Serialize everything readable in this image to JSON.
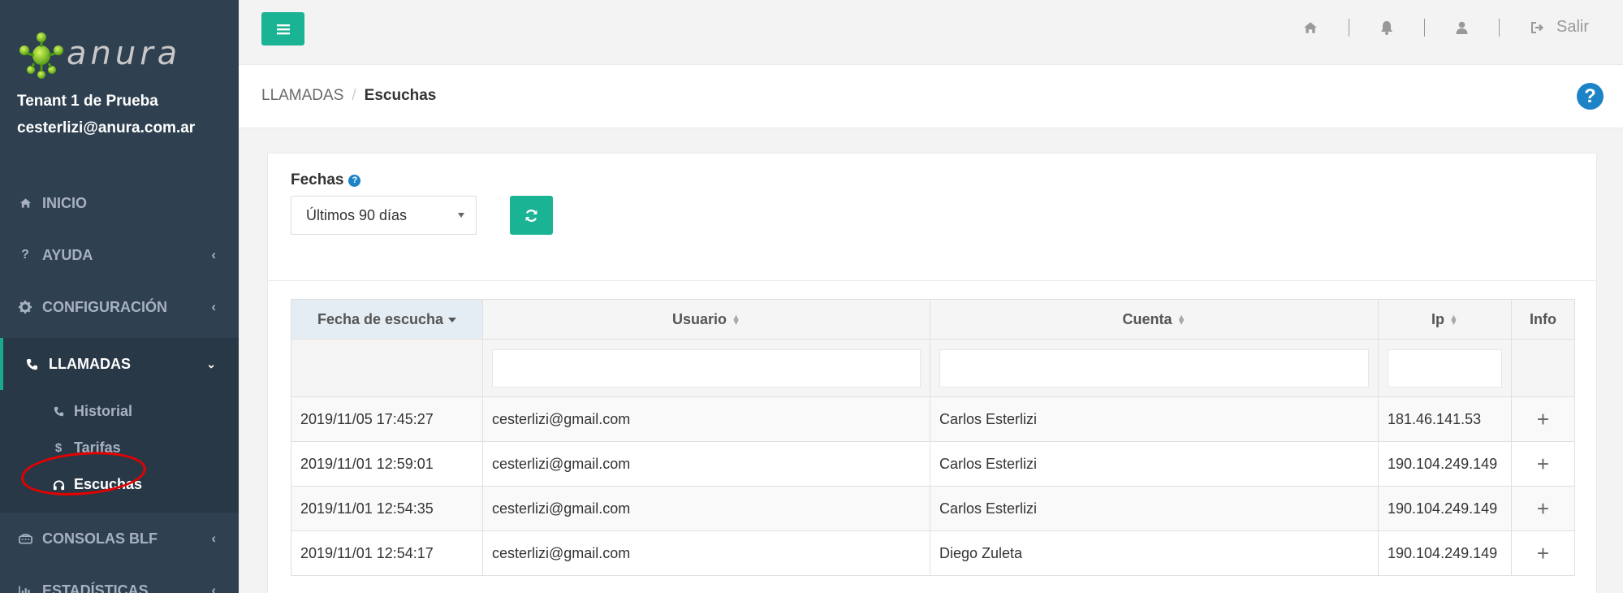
{
  "brand": {
    "logo_text": "anura"
  },
  "user": {
    "tenant": "Tenant 1 de Prueba",
    "email": "cesterlizi@anura.com.ar"
  },
  "sidebar": {
    "items": [
      {
        "label": "INICIO",
        "icon": "home-icon"
      },
      {
        "label": "AYUDA",
        "icon": "question-icon"
      },
      {
        "label": "CONFIGURACIÓN",
        "icon": "gear-icon"
      },
      {
        "label": "LLAMADAS",
        "icon": "phone-icon"
      },
      {
        "label": "CONSOLAS BLF",
        "icon": "console-icon"
      },
      {
        "label": "ESTADÍSTICAS",
        "icon": "bar-chart-icon"
      }
    ],
    "subitems": [
      {
        "label": "Historial",
        "icon": "phone-icon"
      },
      {
        "label": "Tarifas",
        "icon": "dollar-icon"
      },
      {
        "label": "Escuchas",
        "icon": "headphones-icon"
      }
    ]
  },
  "topbar": {
    "logout_label": "Salir"
  },
  "breadcrumb": {
    "parent": "LLAMADAS",
    "current": "Escuchas",
    "separator": "/"
  },
  "filters": {
    "dates_label": "Fechas",
    "dates_value": "Últimos 90 días"
  },
  "table": {
    "headers": [
      "Fecha de escucha",
      "Usuario",
      "Cuenta",
      "Ip",
      "Info"
    ],
    "rows": [
      {
        "fecha": "2019/11/05 17:45:27",
        "usuario": "cesterlizi@gmail.com",
        "cuenta": "Carlos Esterlizi",
        "ip": "181.46.141.53",
        "info": "+"
      },
      {
        "fecha": "2019/11/01 12:59:01",
        "usuario": "cesterlizi@gmail.com",
        "cuenta": "Carlos Esterlizi",
        "ip": "190.104.249.149",
        "info": "+"
      },
      {
        "fecha": "2019/11/01 12:54:35",
        "usuario": "cesterlizi@gmail.com",
        "cuenta": "Carlos Esterlizi",
        "ip": "190.104.249.149",
        "info": "+"
      },
      {
        "fecha": "2019/11/01 12:54:17",
        "usuario": "cesterlizi@gmail.com",
        "cuenta": "Diego Zuleta",
        "ip": "190.104.249.149",
        "info": "+"
      }
    ]
  },
  "colors": {
    "sidebar_bg": "#2f4050",
    "accent": "#1ab394",
    "help": "#1c84c6",
    "annotation": "#e60000"
  }
}
